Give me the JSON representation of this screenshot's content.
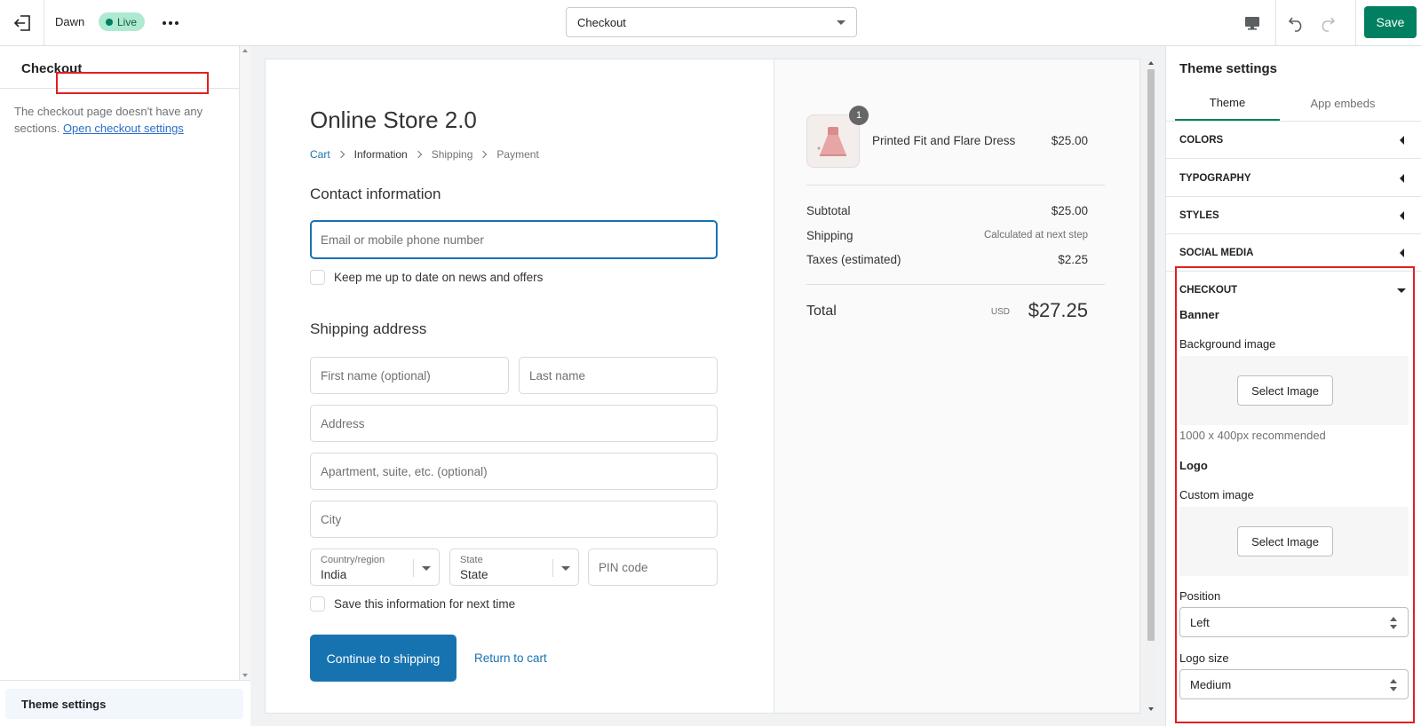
{
  "topbar": {
    "theme_name": "Dawn",
    "status_badge": "Live",
    "page_selector": "Checkout",
    "save_label": "Save"
  },
  "left_sidebar": {
    "title": "Checkout",
    "message": "The checkout page doesn't have any sections.",
    "link_label": "Open checkout settings",
    "footer_item": "Theme settings"
  },
  "preview": {
    "store_name": "Online Store 2.0",
    "breadcrumb": [
      "Cart",
      "Information",
      "Shipping",
      "Payment"
    ],
    "contact_title": "Contact information",
    "email_placeholder": "Email or mobile phone number",
    "newsletter_label": "Keep me up to date on news and offers",
    "shipping_title": "Shipping address",
    "first_name_placeholder": "First name (optional)",
    "last_name_placeholder": "Last name",
    "address_placeholder": "Address",
    "apartment_placeholder": "Apartment, suite, etc. (optional)",
    "city_placeholder": "City",
    "country_label": "Country/region",
    "country_value": "India",
    "state_label": "State",
    "state_value": "State",
    "pin_placeholder": "PIN code",
    "save_info_label": "Save this information for next time",
    "continue_label": "Continue to shipping",
    "return_label": "Return to cart",
    "order": {
      "quantity": "1",
      "product_name": "Printed Fit and Flare Dress",
      "product_price": "$25.00",
      "subtotal_label": "Subtotal",
      "subtotal_value": "$25.00",
      "shipping_label": "Shipping",
      "shipping_value": "Calculated at next step",
      "taxes_label": "Taxes (estimated)",
      "taxes_value": "$2.25",
      "total_label": "Total",
      "total_currency": "USD",
      "total_value": "$27.25"
    }
  },
  "right_panel": {
    "title": "Theme settings",
    "tabs": [
      "Theme",
      "App embeds"
    ],
    "sections": [
      "COLORS",
      "TYPOGRAPHY",
      "STYLES",
      "SOCIAL MEDIA",
      "CHECKOUT"
    ],
    "checkout": {
      "banner_heading": "Banner",
      "background_image_label": "Background image",
      "select_image_label": "Select Image",
      "banner_help": "1000 x 400px recommended",
      "logo_heading": "Logo",
      "custom_image_label": "Custom image",
      "position_label": "Position",
      "position_value": "Left",
      "logo_size_label": "Logo size",
      "logo_size_value": "Medium"
    }
  },
  "colors": {
    "primary_green": "#008060",
    "live_badge_bg": "#aee9d1",
    "checkout_blue": "#1773b0",
    "highlight_red": "#e02020"
  }
}
